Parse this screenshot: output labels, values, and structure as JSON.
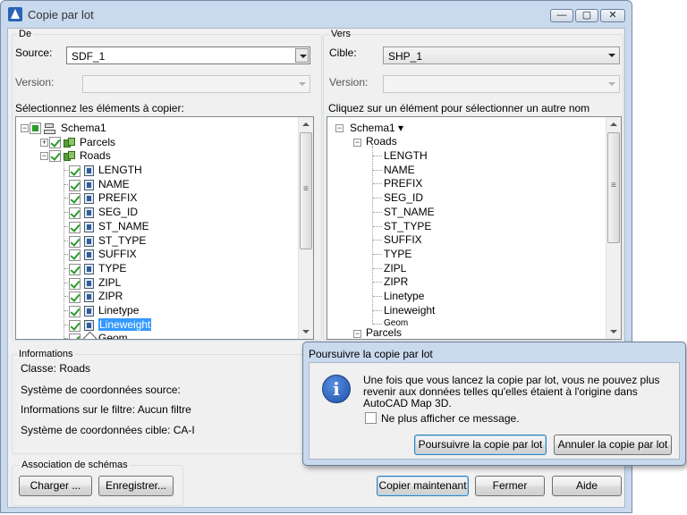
{
  "window": {
    "title": "Copie par lot",
    "controls": {
      "minimize": "—",
      "maximize": "▢",
      "close": "✕"
    }
  },
  "de": {
    "group_label": "De",
    "source_label": "Source:",
    "source_value": "SDF_1",
    "version_label": "Version:",
    "version_value": "",
    "tree_label": "Sélectionnez les éléments à copier:",
    "tree": {
      "schema": "Schema1",
      "parcels": "Parcels",
      "roads": "Roads",
      "fields": [
        "LENGTH",
        "NAME",
        "PREFIX",
        "SEG_ID",
        "ST_NAME",
        "ST_TYPE",
        "SUFFIX",
        "TYPE",
        "ZIPL",
        "ZIPR",
        "Linetype",
        "Lineweight",
        "Geom"
      ],
      "selected_field": "Lineweight"
    }
  },
  "vers": {
    "group_label": "Vers",
    "cible_label": "Cible:",
    "cible_value": "SHP_1",
    "version_label": "Version:",
    "version_value": "",
    "tree_label": "Cliquez sur un élément pour sélectionner un autre nom d'entrée:",
    "tree": {
      "schema": "Schema1 ▾",
      "roads": "Roads",
      "fields": [
        "LENGTH",
        "NAME",
        "PREFIX",
        "SEG_ID",
        "ST_NAME",
        "ST_TYPE",
        "SUFFIX",
        "TYPE",
        "ZIPL",
        "ZIPR",
        "Linetype",
        "Lineweight",
        "Geom"
      ],
      "parcels": "Parcels"
    }
  },
  "informations": {
    "group_label": "Informations",
    "classe": "Classe: Roads",
    "systeme_source": "Système de coordonnées source:",
    "filtre": "Informations sur le filtre: Aucun filtre",
    "systeme_cible": "Système de coordonnées cible: CA-I"
  },
  "association": {
    "group_label": "Association de schémas",
    "charger": "Charger ...",
    "enregistrer": "Enregistrer..."
  },
  "buttons": {
    "copier": "Copier maintenant",
    "fermer": "Fermer",
    "aide": "Aide"
  },
  "dialog": {
    "title": "Poursuivre la copie par lot",
    "message": "Une fois que vous lancez la copie par lot, vous ne pouvez plus revenir aux données telles qu'elles étaient à l'origine dans AutoCAD Map 3D.",
    "checkbox_label": "Ne plus afficher ce message.",
    "ok": "Poursuivre la copie par lot",
    "cancel": "Annuler la copie par lot",
    "icon": "info-icon"
  }
}
